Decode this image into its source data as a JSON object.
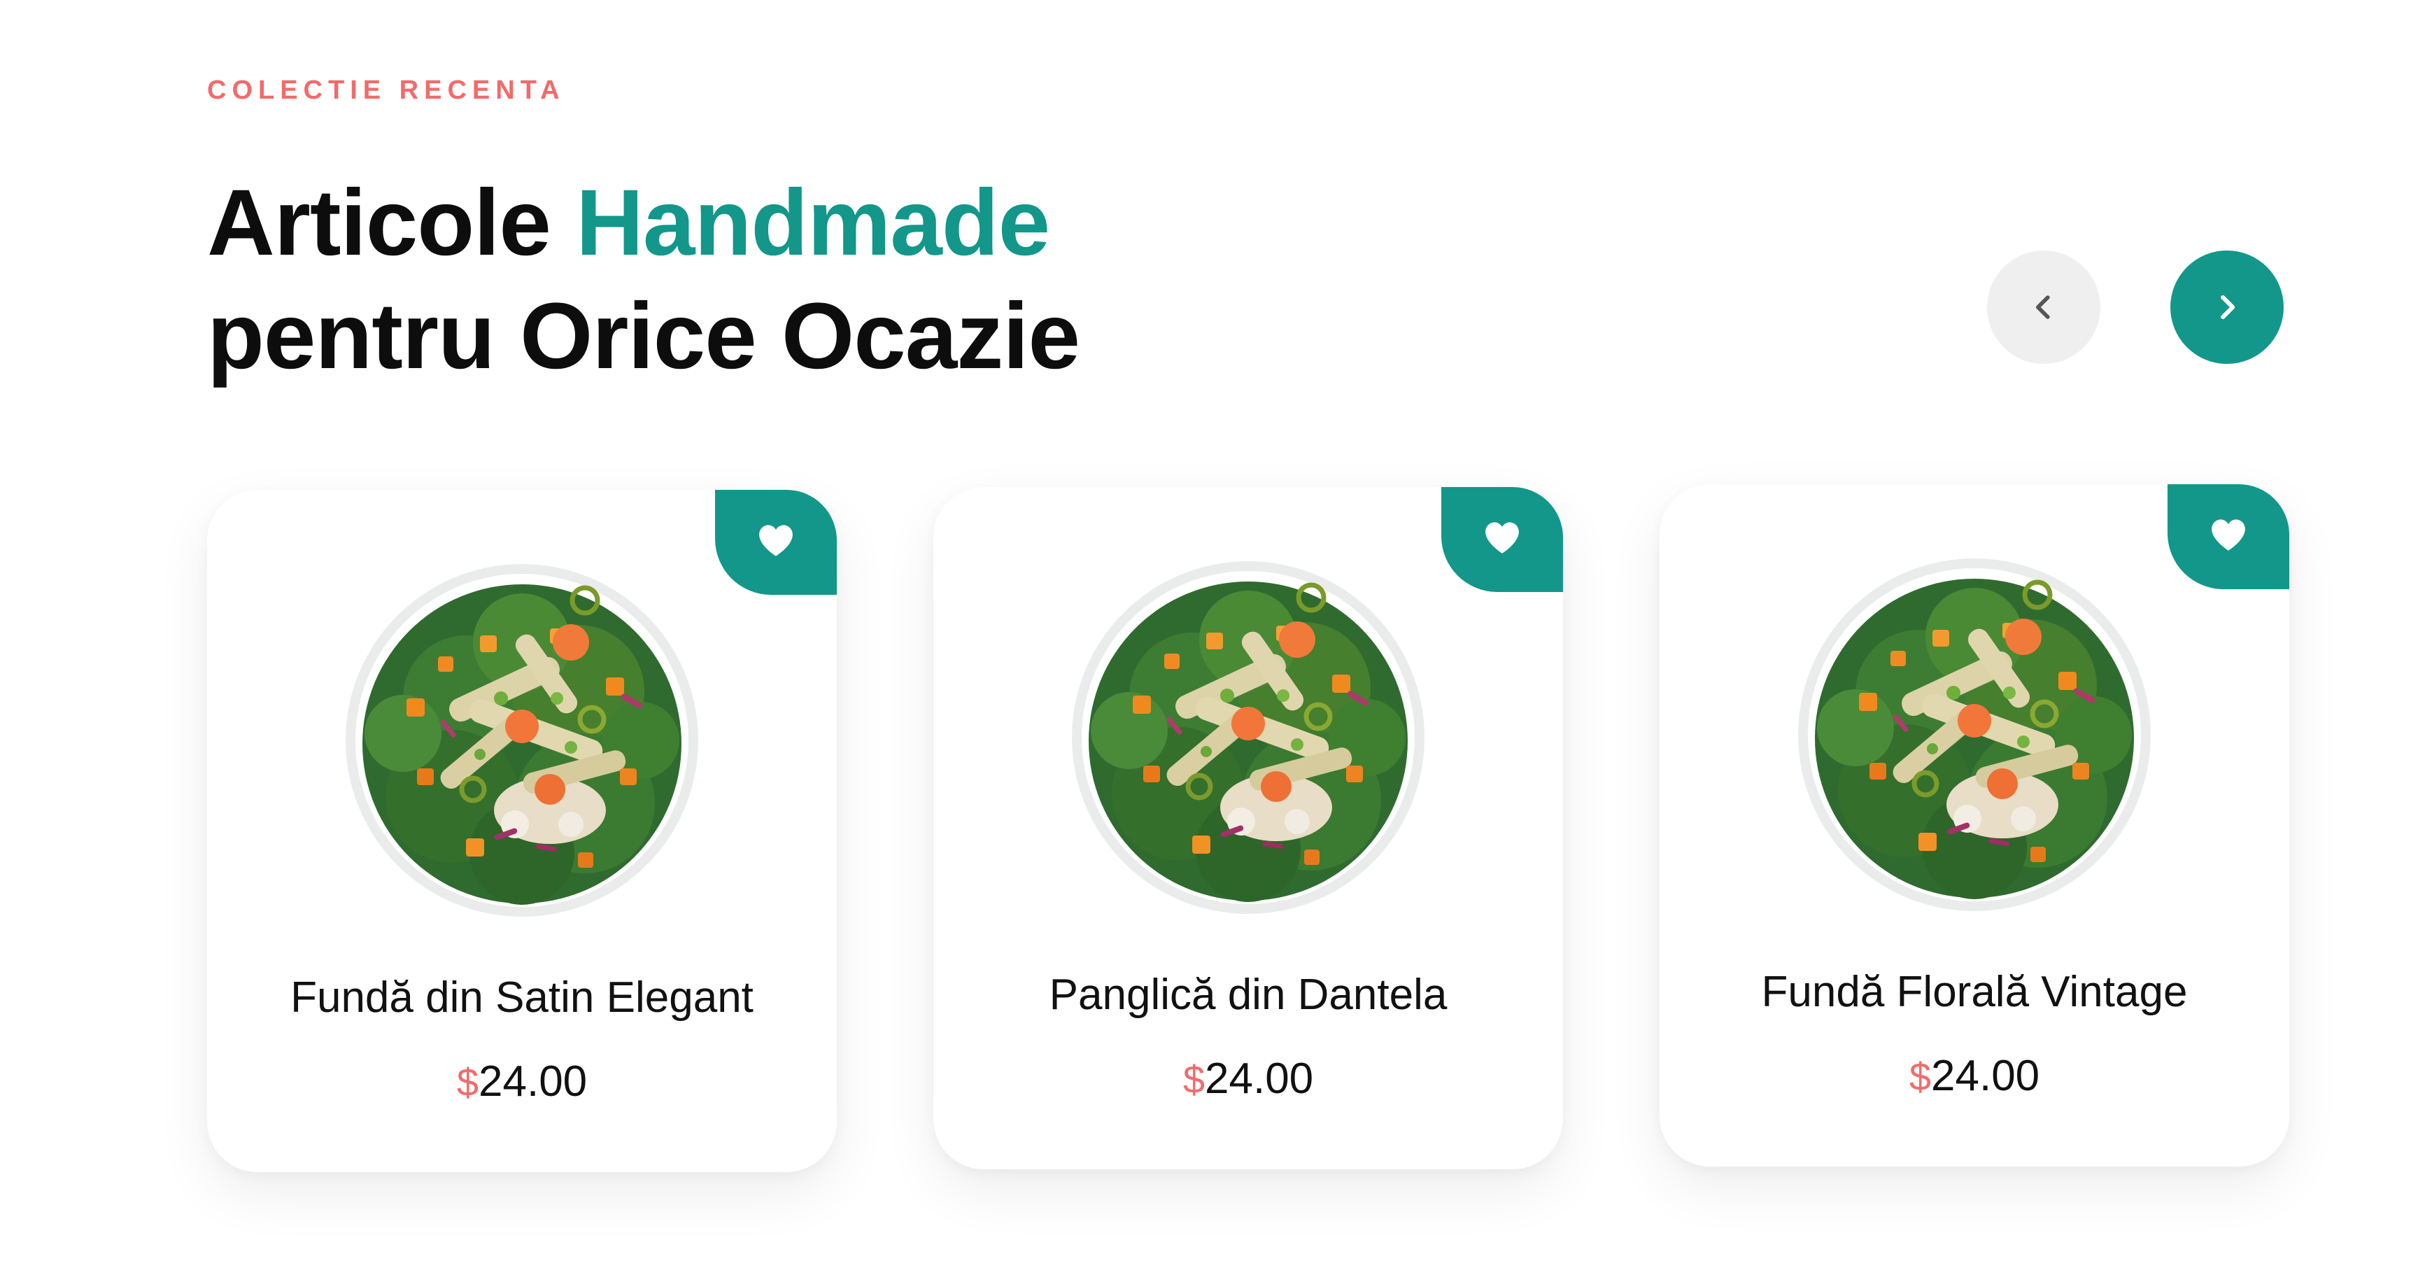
{
  "section": {
    "eyebrow": "COLECTIE RECENTA",
    "title_line1_part1": "Articole ",
    "title_line1_highlight": "Handmade",
    "title_line2": "pentru Orice Ocazie"
  },
  "carousel": {
    "prev_icon": "chevron-left-icon",
    "next_icon": "chevron-right-icon"
  },
  "products": [
    {
      "name": "Fundă din Satin Elegant",
      "currency": "$",
      "price": "24.00",
      "image": "salad-bowl-image",
      "favorite_icon": "heart-icon"
    },
    {
      "name": "Panglică din Dantela",
      "currency": "$",
      "price": "24.00",
      "image": "salad-bowl-image",
      "favorite_icon": "heart-icon"
    },
    {
      "name": "Fundă Florală Vintage",
      "currency": "$",
      "price": "24.00",
      "image": "salad-bowl-image",
      "favorite_icon": "heart-icon"
    }
  ],
  "colors": {
    "accent": "#12978a",
    "eyebrow": "#f26b6b",
    "price_currency": "#f26b6b",
    "nav_prev_bg": "#efefef"
  }
}
